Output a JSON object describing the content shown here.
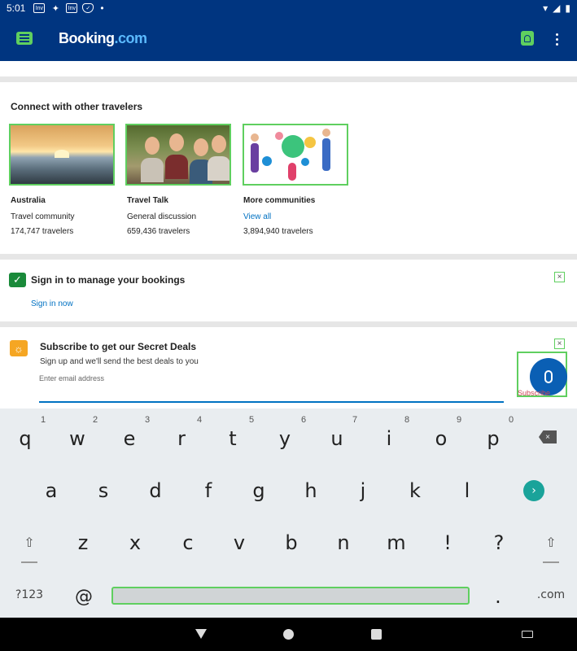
{
  "status_bar": {
    "time": "5:01",
    "icons": [
      "inv-icon",
      "twitter-icon",
      "inv-icon",
      "shield-check-icon"
    ],
    "icon_text": "Inv"
  },
  "app_bar": {
    "logo_main": "Booking",
    "logo_suffix": ".com"
  },
  "connect": {
    "title": "Connect with other travelers",
    "cards": [
      {
        "name": "Australia",
        "subtitle": "Travel community",
        "count": "174,747 travelers"
      },
      {
        "name": "Travel Talk",
        "subtitle": "General discussion",
        "count": "659,436 travelers"
      },
      {
        "name": "More communities",
        "subtitle": "View all",
        "count": "3,894,940 travelers"
      }
    ]
  },
  "sign_in": {
    "title": "Sign in to manage your bookings",
    "link": "Sign in now",
    "close": "×"
  },
  "subscribe": {
    "title": "Subscribe to get our Secret Deals",
    "description": "Sign up and we'll send the best deals to you",
    "email_placeholder": "Enter email address",
    "button_label": "Subscribe",
    "close": "×"
  },
  "keyboard": {
    "numbers": [
      "1",
      "2",
      "3",
      "4",
      "5",
      "6",
      "7",
      "8",
      "9",
      "0"
    ],
    "row1": [
      "q",
      "w",
      "e",
      "r",
      "t",
      "y",
      "u",
      "i",
      "o",
      "p"
    ],
    "row2": [
      "a",
      "s",
      "d",
      "f",
      "g",
      "h",
      "j",
      "k",
      "l"
    ],
    "row3": [
      "z",
      "x",
      "c",
      "v",
      "b",
      "n",
      "m",
      "!",
      "?"
    ],
    "symbols_key": "?123",
    "at_key": "@",
    "period_key": ".",
    "dotcom_key": ".com",
    "enter_glyph": "›",
    "shift_glyph": "⇧",
    "backspace_glyph": "×"
  },
  "colors": {
    "brand": "#003580",
    "accent": "#0071c2",
    "enter": "#1aa39a"
  }
}
